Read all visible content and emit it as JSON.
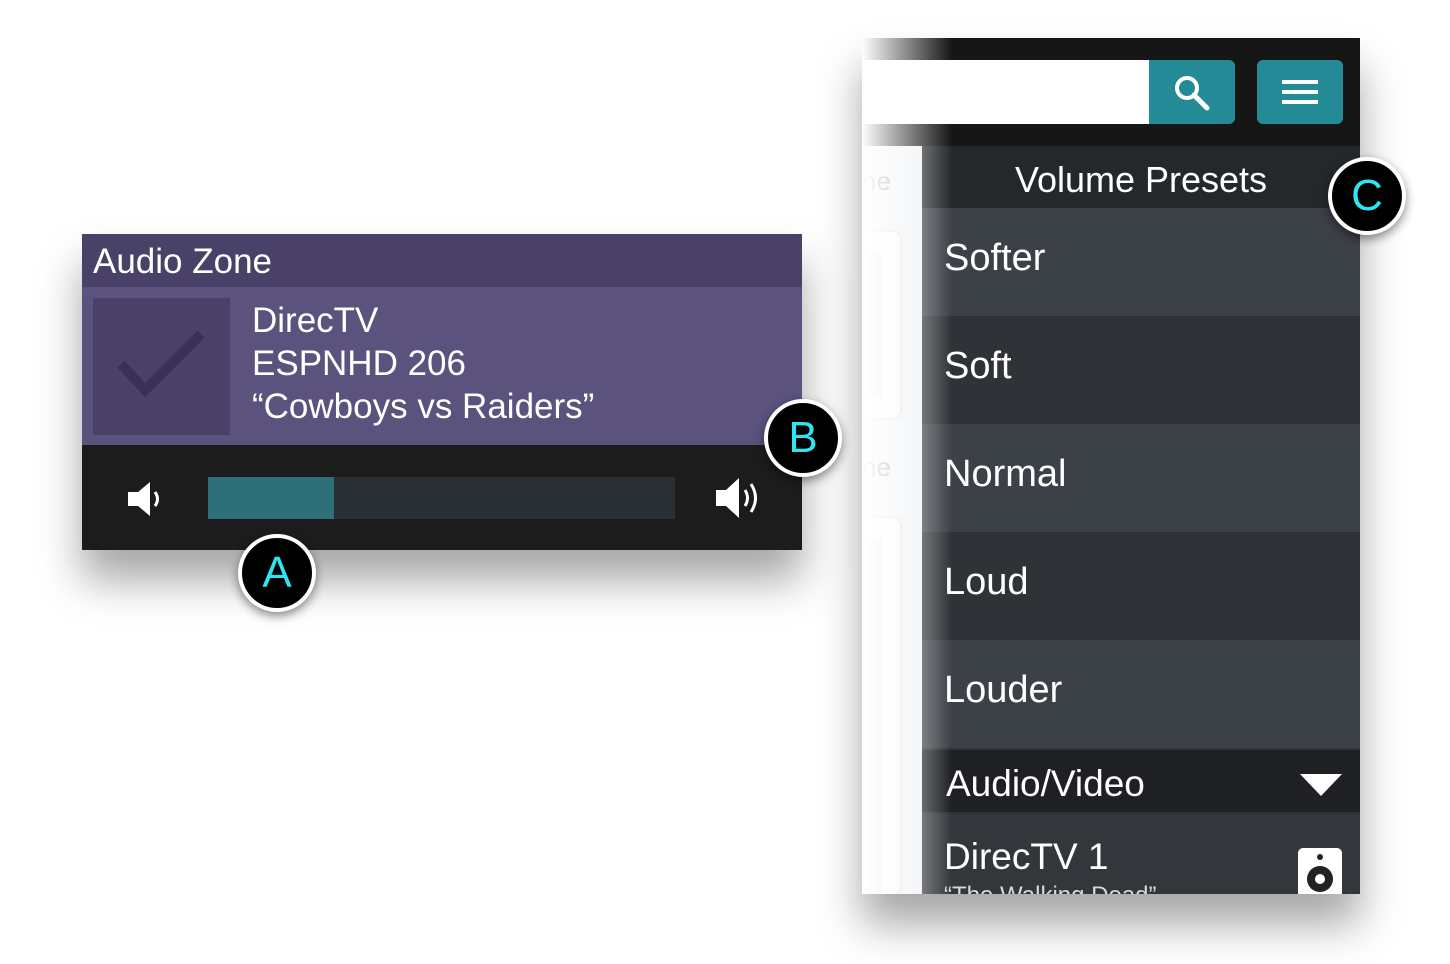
{
  "audio_zone": {
    "title": "Audio Zone",
    "source": "DirecTV",
    "channel": "ESPNHD 206",
    "program": "“Cowboys vs Raiders”",
    "volume_fraction": 0.27,
    "colors": {
      "header": "#4a4168",
      "body": "#5b527d",
      "slider_fill": "#2f6f79"
    }
  },
  "topbar": {
    "search_placeholder": "",
    "accent": "#238a96"
  },
  "background_labels": [
    "ne",
    "ne"
  ],
  "volume_presets": {
    "title": "Volume Presets",
    "items": [
      {
        "label": "Softer"
      },
      {
        "label": "Soft"
      },
      {
        "label": "Normal"
      },
      {
        "label": "Loud"
      },
      {
        "label": "Louder"
      }
    ]
  },
  "audio_video": {
    "title": "Audio/Video",
    "item_title": "DirecTV 1",
    "item_subtitle": "“The Walking Dead”"
  },
  "callouts": {
    "a": "A",
    "b": "B",
    "c": "C"
  }
}
